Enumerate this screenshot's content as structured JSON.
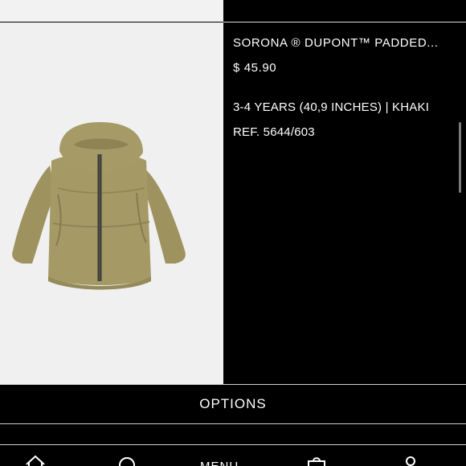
{
  "product": {
    "name": "SORONA ® DUPONT™ PADDED...",
    "price": "$ 45.90",
    "variant": "3-4 YEARS (40,9 INCHES) | KHAKI",
    "ref": "REF. 5644/603",
    "image": "khaki-hooded-padded-jacket"
  },
  "actions": {
    "options_label": "OPTIONS"
  },
  "bottom_nav": {
    "items": [
      {
        "icon": "home-icon"
      },
      {
        "icon": "search-icon"
      },
      {
        "label": "MENU"
      },
      {
        "icon": "bag-icon"
      },
      {
        "icon": "user-icon"
      }
    ]
  },
  "colors": {
    "background": "#000000",
    "image_bg": "#f0f0f0",
    "jacket": "#a59a66",
    "text": "#ffffff"
  }
}
